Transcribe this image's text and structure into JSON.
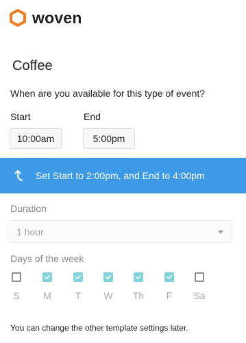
{
  "brand": {
    "name": "woven",
    "accent": "#f07d21"
  },
  "event": {
    "title": "Coffee",
    "question": "When are you available for this type of event?",
    "start_label": "Start",
    "end_label": "End",
    "start_value": "10:00am",
    "end_value": "5:00pm"
  },
  "suggestion": {
    "text": "Set Start to 2:00pm, and End to 4:00pm",
    "background": "#3d9ae6",
    "icon": "curved-up-arrow-icon"
  },
  "duration": {
    "label": "Duration",
    "value": "1 hour"
  },
  "days": {
    "label": "Days of the week",
    "items": [
      {
        "letter": "S",
        "checked": false
      },
      {
        "letter": "M",
        "checked": true
      },
      {
        "letter": "T",
        "checked": true
      },
      {
        "letter": "W",
        "checked": true
      },
      {
        "letter": "Th",
        "checked": true
      },
      {
        "letter": "F",
        "checked": true
      },
      {
        "letter": "Sa",
        "checked": false
      }
    ]
  },
  "footnote": "You can change the other template settings later."
}
